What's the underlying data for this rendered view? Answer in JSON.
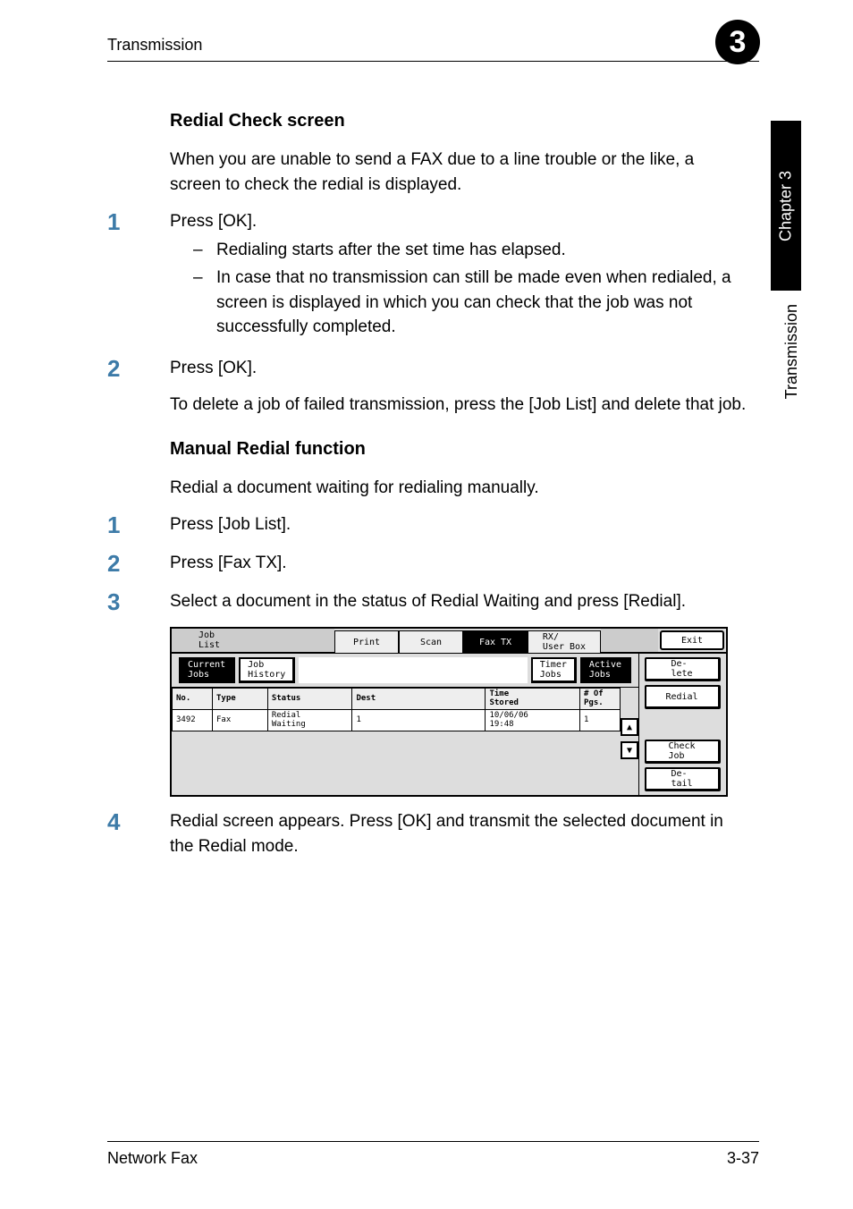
{
  "running_head": "Transmission",
  "chapter_badge": "3",
  "side_tab_black": "Chapter 3",
  "side_tab_white": "Transmission",
  "section_heading_1": "Redial Check screen",
  "intro_para_1": "When you are unable to send a FAX due to a line trouble or the like, a screen to check the redial is displayed.",
  "step1_num": "1",
  "step1_body": "Press [OK].",
  "step1_sub1": "Redialing starts after the set time has elapsed.",
  "step1_sub2": "In case that no transmission can still be made even when redialed, a screen is displayed in which you can check that the job was not successfully completed.",
  "step2_num": "2",
  "step2_body": "Press [OK].",
  "step2_extra": "To delete a job of failed transmission, press the [Job List] and delete that job.",
  "section_heading_2": "Manual Redial function",
  "intro_para_2": "Redial a document waiting for redialing manually.",
  "step3_num": "1",
  "step3_body": "Press [Job List].",
  "step4_num": "2",
  "step4_body": "Press [Fax TX].",
  "step5_num": "3",
  "step5_body": "Select a document in the status of Redial Waiting and press [Redial].",
  "step6_num": "4",
  "step6_body": "Redial screen appears. Press [OK] and transmit the selected document in the Redial mode.",
  "scr": {
    "joblist_label": "Job\nList",
    "tab_print": "Print",
    "tab_scan": "Scan",
    "tab_faxtx": "Fax TX",
    "tab_rxuser": "RX/\nUser Box",
    "exit": "Exit",
    "sub_current": "Current\nJobs",
    "sub_history": "Job\nHistory",
    "sub_timer": "Timer\nJobs",
    "sub_active": "Active\nJobs",
    "col_no": "No.",
    "col_type": "Type",
    "col_status": "Status",
    "col_dest": "Dest",
    "col_time": "Time\nStored",
    "col_pgs": "# Of\nPgs.",
    "row_no": "3492",
    "row_type": "Fax",
    "row_status": "Redial\nWaiting",
    "row_dest": "1",
    "row_time": "10/06/06\n19:48",
    "row_pgs": "1",
    "btn_delete": "De-\nlete",
    "btn_redial": "Redial",
    "btn_checkjob": "Check\nJob",
    "btn_detail": "De-\ntail",
    "arrow_up": "▲",
    "arrow_down": "▼"
  },
  "footer_left": "Network Fax",
  "footer_right": "3-37"
}
